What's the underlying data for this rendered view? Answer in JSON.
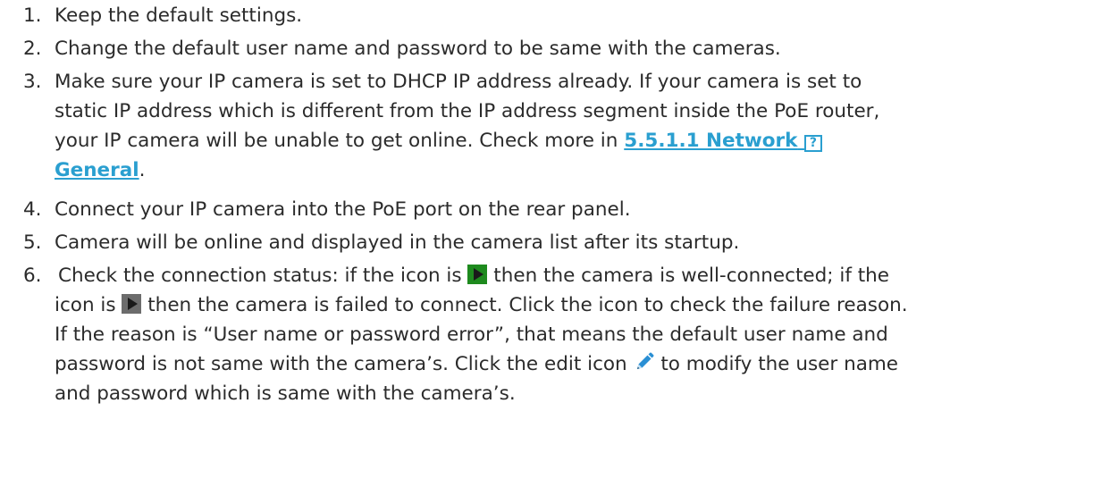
{
  "steps": [
    {
      "num": "1.",
      "text": "Keep the default settings."
    },
    {
      "num": "2.",
      "text": "Change the default user name and password to be same with the cameras."
    },
    {
      "num": "3.",
      "line1": "Make sure your IP camera is set to DHCP IP address already. If your camera is set to",
      "line2": "static IP address which is different from the IP address segment inside the PoE router,",
      "line3_text": "your IP camera will be unable to get online. Check more in ",
      "link_part1": "5.5.1.1 Network",
      "link_symbol": "?",
      "link_part2": "General",
      "after_link": "."
    },
    {
      "num": "4.",
      "text": "Connect your IP camera into the PoE port on the rear panel."
    },
    {
      "num": "5.",
      "text": "Camera will be online and displayed in the camera list after its startup."
    },
    {
      "num": "6.",
      "a1": "Check the connection status: if the icon is ",
      "a2": " then the camera is well-connected; if the",
      "b1": "icon is ",
      "b2": " then the camera is failed to connect. Click the icon to check the failure reason.",
      "c": "If the reason is “User name or password error”, that means the default user name and",
      "d1": "password is not same with the camera’s. Click the edit icon ",
      "d2": " to modify the user name",
      "e": "and password which is same with the camera’s."
    }
  ],
  "icons": {
    "connected": "green-play-icon",
    "failed": "gray-play-icon",
    "edit": "pencil-icon",
    "link_color": "#2a9fd0",
    "connected_color": "#1e8a1e",
    "failed_color": "#6c6c6c"
  }
}
